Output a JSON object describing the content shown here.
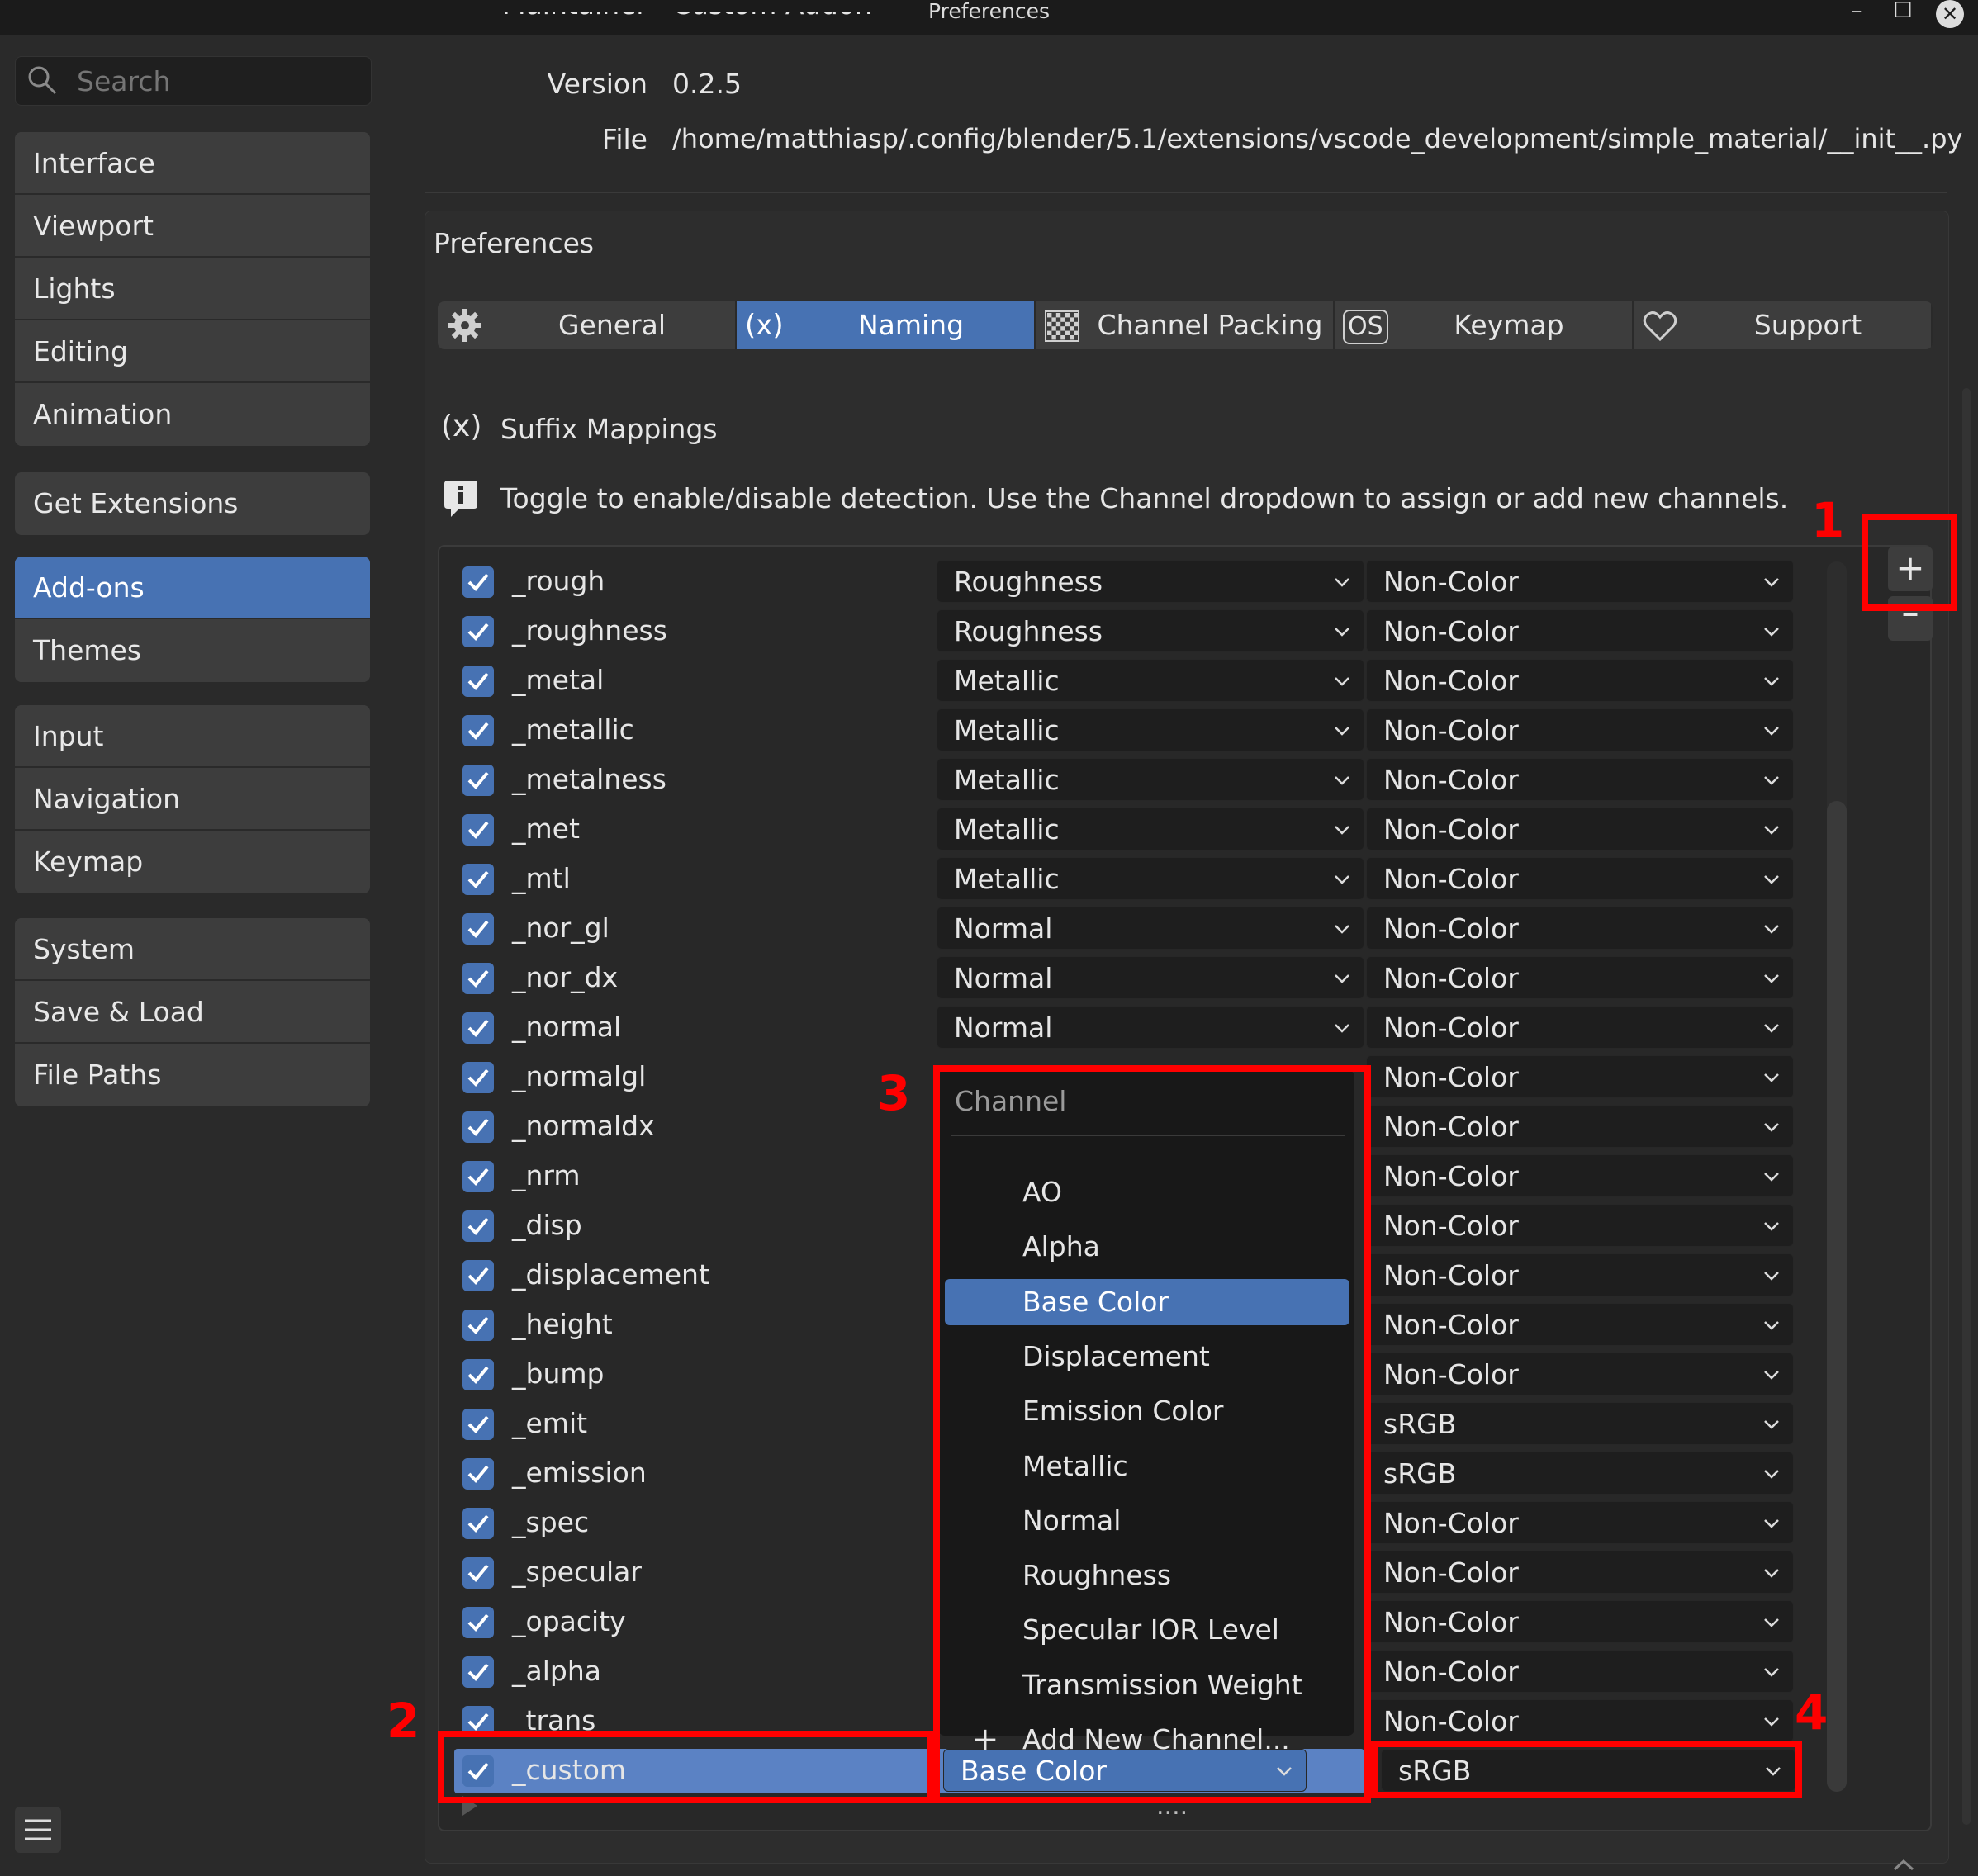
{
  "window": {
    "title": "Preferences",
    "minimize": "–",
    "maximize": "☐",
    "close": "✕"
  },
  "sidebar": {
    "search_placeholder": "Search",
    "groups": [
      [
        "Interface",
        "Viewport",
        "Lights",
        "Editing",
        "Animation"
      ],
      [
        "Get Extensions"
      ],
      [
        "Add-ons",
        "Themes"
      ],
      [
        "Input",
        "Navigation",
        "Keymap"
      ],
      [
        "System",
        "Save & Load",
        "File Paths"
      ]
    ],
    "active": "Add-ons"
  },
  "addon_info": {
    "maintainer_label": "Maintainer",
    "maintainer_value": "Custom Addon",
    "version_label": "Version",
    "version_value": "0.2.5",
    "file_label": "File",
    "file_value": "/home/matthiasp/.config/blender/5.1/extensions/vscode_development/simple_material/__init__.py"
  },
  "preferences": {
    "heading": "Preferences",
    "tabs": [
      {
        "icon": "gear-icon",
        "label": "General",
        "active": false
      },
      {
        "icon": "variable-icon",
        "icon_text": "(x)",
        "label": "Naming",
        "active": true
      },
      {
        "icon": "checker-icon",
        "label": "Channel Packing",
        "active": false
      },
      {
        "icon": "os-icon",
        "icon_text": "OS",
        "label": "Keymap",
        "active": false
      },
      {
        "icon": "heart-icon",
        "label": "Support",
        "active": false
      }
    ],
    "section_icon_text": "(x)",
    "section_title": "Suffix Mappings",
    "info_text": "Toggle to enable/disable detection. Use the Channel dropdown to assign or add new channels."
  },
  "mappings": [
    {
      "suffix": "_rough",
      "channel": "Roughness",
      "colorspace": "Non-Color"
    },
    {
      "suffix": "_roughness",
      "channel": "Roughness",
      "colorspace": "Non-Color"
    },
    {
      "suffix": "_metal",
      "channel": "Metallic",
      "colorspace": "Non-Color"
    },
    {
      "suffix": "_metallic",
      "channel": "Metallic",
      "colorspace": "Non-Color"
    },
    {
      "suffix": "_metalness",
      "channel": "Metallic",
      "colorspace": "Non-Color"
    },
    {
      "suffix": "_met",
      "channel": "Metallic",
      "colorspace": "Non-Color"
    },
    {
      "suffix": "_mtl",
      "channel": "Metallic",
      "colorspace": "Non-Color"
    },
    {
      "suffix": "_nor_gl",
      "channel": "Normal",
      "colorspace": "Non-Color"
    },
    {
      "suffix": "_nor_dx",
      "channel": "Normal",
      "colorspace": "Non-Color"
    },
    {
      "suffix": "_normal",
      "channel": "Normal",
      "colorspace": "Non-Color"
    },
    {
      "suffix": "_normalgl",
      "channel": "",
      "colorspace": "Non-Color"
    },
    {
      "suffix": "_normaldx",
      "channel": "",
      "colorspace": "Non-Color"
    },
    {
      "suffix": "_nrm",
      "channel": "",
      "colorspace": "Non-Color"
    },
    {
      "suffix": "_disp",
      "channel": "",
      "colorspace": "Non-Color"
    },
    {
      "suffix": "_displacement",
      "channel": "",
      "colorspace": "Non-Color"
    },
    {
      "suffix": "_height",
      "channel": "",
      "colorspace": "Non-Color"
    },
    {
      "suffix": "_bump",
      "channel": "",
      "colorspace": "Non-Color"
    },
    {
      "suffix": "_emit",
      "channel": "",
      "colorspace": "sRGB"
    },
    {
      "suffix": "_emission",
      "channel": "",
      "colorspace": "sRGB"
    },
    {
      "suffix": "_spec",
      "channel": "",
      "colorspace": "Non-Color"
    },
    {
      "suffix": "_specular",
      "channel": "",
      "colorspace": "Non-Color"
    },
    {
      "suffix": "_opacity",
      "channel": "",
      "colorspace": "Non-Color"
    },
    {
      "suffix": "_alpha",
      "channel": "",
      "colorspace": "Non-Color"
    },
    {
      "suffix": "_trans",
      "channel": "",
      "colorspace": "Non-Color"
    },
    {
      "suffix": "_custom",
      "channel": "Base Color",
      "colorspace": "sRGB",
      "selected": true
    }
  ],
  "channel_popup": {
    "title": "Channel",
    "items": [
      "AO",
      "Alpha",
      "Base Color",
      "Displacement",
      "Emission Color",
      "Metallic",
      "Normal",
      "Roughness",
      "Specular IOR Level",
      "Transmission Weight"
    ],
    "selected": "Base Color",
    "add_label": "Add New Channel..."
  },
  "list_controls": {
    "add": "+",
    "remove": "–",
    "more": "...."
  },
  "annotations": [
    "1",
    "2",
    "3",
    "4"
  ],
  "colors": {
    "accent": "#4772b3",
    "annotation": "#ff0000",
    "background": "#2a2a2a"
  }
}
